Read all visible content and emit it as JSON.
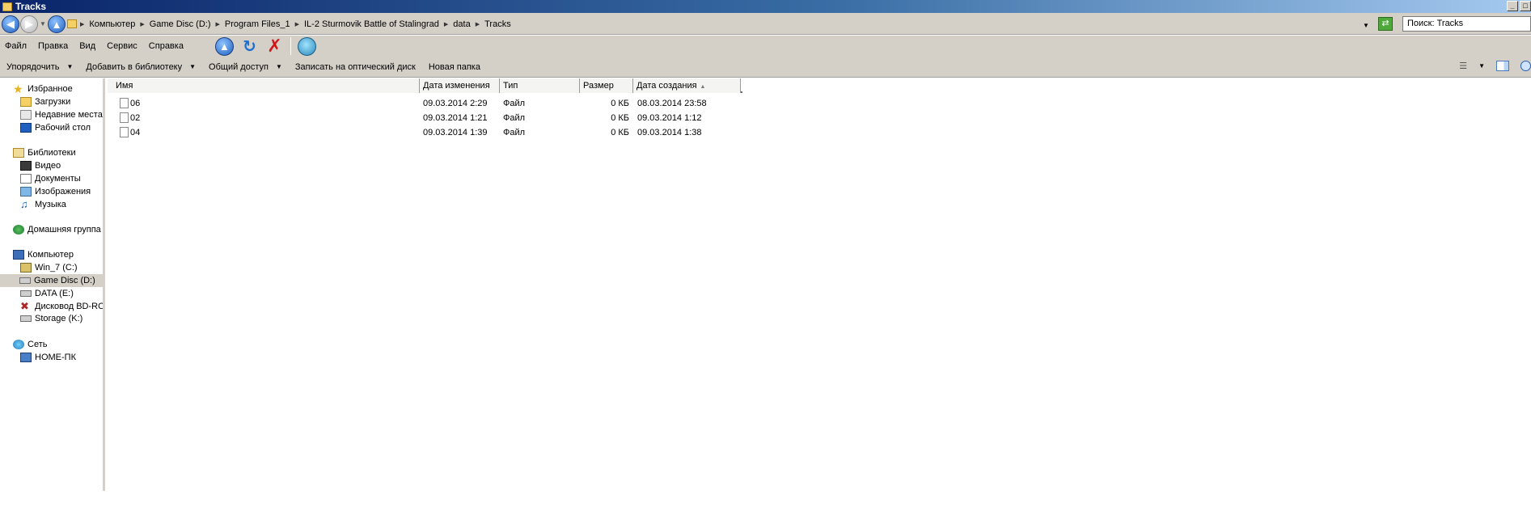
{
  "window": {
    "title": "Tracks",
    "controls": [
      "_",
      "□"
    ]
  },
  "address": {
    "breadcrumbs": [
      "Компьютер",
      "Game Disc (D:)",
      "Program Files_1",
      "IL-2 Sturmovik Battle of Stalingrad",
      "data",
      "Tracks"
    ],
    "search_placeholder": "Поиск: Tracks"
  },
  "menubar": {
    "items": [
      "Файл",
      "Правка",
      "Вид",
      "Сервис",
      "Справка"
    ]
  },
  "commandbar": {
    "organize": "Упорядочить",
    "add_to_library": "Добавить в библиотеку",
    "share": "Общий доступ",
    "burn": "Записать на оптический диск",
    "new_folder": "Новая папка"
  },
  "navpane": {
    "favorites": {
      "label": "Избранное",
      "items": [
        "Загрузки",
        "Недавние места",
        "Рабочий стол"
      ]
    },
    "libraries": {
      "label": "Библиотеки",
      "items": [
        "Видео",
        "Документы",
        "Изображения",
        "Музыка"
      ]
    },
    "homegroup": {
      "label": "Домашняя группа"
    },
    "computer": {
      "label": "Компьютер",
      "items": [
        "Win_7 (C:)",
        "Game Disc (D:)",
        "DATA (E:)",
        "Дисковод BD-ROM (H",
        "Storage (K:)"
      ],
      "selected_index": 1
    },
    "network": {
      "label": "Сеть",
      "items": [
        "HOME-ПК"
      ]
    }
  },
  "filelist": {
    "columns": {
      "name": "Имя",
      "modified": "Дата изменения",
      "type": "Тип",
      "size": "Размер",
      "created": "Дата создания"
    },
    "sorted_by": "created",
    "rows": [
      {
        "name": "06",
        "modified": "09.03.2014 2:29",
        "type": "Файл",
        "size": "0 КБ",
        "created": "08.03.2014 23:58"
      },
      {
        "name": "02",
        "modified": "09.03.2014 1:21",
        "type": "Файл",
        "size": "0 КБ",
        "created": "09.03.2014 1:12"
      },
      {
        "name": "04",
        "modified": "09.03.2014 1:39",
        "type": "Файл",
        "size": "0 КБ",
        "created": "09.03.2014 1:38"
      }
    ]
  }
}
